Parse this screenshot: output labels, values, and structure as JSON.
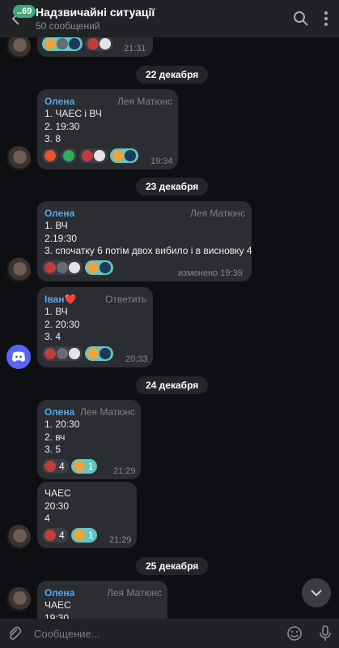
{
  "header": {
    "badge": "..69",
    "title": "Надзвичайні ситуації",
    "subtitle": "50 сообщений"
  },
  "dates": [
    "22 декабря",
    "23 декабря",
    "24 декабря",
    "25 декабря"
  ],
  "messages": [
    {
      "time": "21:31"
    },
    {
      "sender": "Олена",
      "action": "Лея Матюнс",
      "lines": "1. ЧАЕС і ВЧ\n2. 19:30\n3. 8",
      "time": "19:34"
    },
    {
      "sender": "Олена",
      "action": "Лея Матюнс",
      "lines": "1. ВЧ\n2.19:30\n3. спочатку 6 потім двох вибило і в висновку 4",
      "time": "изменено 19:39"
    },
    {
      "sender": "Іван❤️",
      "action": "Ответить",
      "lines": "1. ВЧ\n2. 20:30\n3. 4",
      "time": "20:33"
    },
    {
      "sender": "Олена",
      "action": "Лея Матюнс",
      "lines": "1. 20:30\n2. вч\n3. 5",
      "time": "21:29",
      "counts": [
        "4",
        "1"
      ]
    },
    {
      "lines": "ЧАЕС\n20:30\n4",
      "time": "21:29",
      "counts": [
        "4",
        "1"
      ]
    },
    {
      "sender": "Олена",
      "action": "Лея Матюнс",
      "lines": "ЧАЕС\n19:30"
    }
  ],
  "composer": {
    "placeholder": "Сообщение..."
  },
  "colors": {
    "accent": "#54a9e6",
    "bubble": "#2b2d33",
    "background": "#0e0f12",
    "reaction_teal": "#5ac8c4"
  }
}
